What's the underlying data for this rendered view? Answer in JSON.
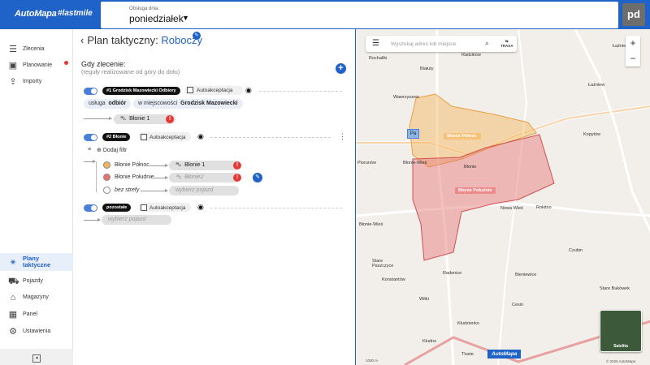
{
  "app": {
    "brand": "AutoMapa",
    "brand_tag": "#lastmile",
    "avatar": "pd"
  },
  "day": {
    "label": "Obsługa dnia:",
    "value": "poniedziałek"
  },
  "sidebar": {
    "items": [
      {
        "label": "Zlecenia",
        "icon": "list-icon"
      },
      {
        "label": "Planowanie",
        "icon": "calendar-icon"
      },
      {
        "label": "Importy",
        "icon": "import-icon"
      }
    ],
    "bottom_items": [
      {
        "label": "Plany taktyczne",
        "icon": "plan-icon"
      },
      {
        "label": "Pojazdy",
        "icon": "truck-icon"
      },
      {
        "label": "Magazyny",
        "icon": "warehouse-icon"
      },
      {
        "label": "Panel",
        "icon": "grid-icon"
      },
      {
        "label": "Ustawienia",
        "icon": "gear-icon"
      }
    ]
  },
  "plan": {
    "title": "Plan taktyczny:",
    "status": "Roboczy",
    "rule_title": "Gdy zlecenie:",
    "rule_sub": "(reguły realizowane od góry do dołu)",
    "rules": [
      {
        "name": "#1 Grodzisk Mazowiecki Odbiory",
        "auto_label": "Autoakceptacja",
        "conditions": [
          {
            "key": "usługa",
            "value": "odbiór"
          },
          {
            "key": "w miejscowości",
            "value": "Grodzisk Mazowiecki"
          }
        ],
        "vehicle": "Błonie 1"
      },
      {
        "name": "#2 Błonie",
        "auto_label": "Autoakceptacja",
        "add_filter": "Dodaj filtr",
        "zones": [
          {
            "label": "Błonie Północ",
            "vehicle": "Błonie 1",
            "color": "#f4b45a"
          },
          {
            "label": "Błonie Południe",
            "vehicle": "Błonie2",
            "color": "#e57373"
          },
          {
            "label": "bez strefy",
            "vehicle": "wybierz pojazd",
            "color": "#ffffff"
          }
        ]
      },
      {
        "name": "pozostałe",
        "auto_label": "Autoakceptacja",
        "vehicle": "wybierz pojazd"
      }
    ]
  },
  "map": {
    "search_placeholder": "Wyszukaj adres lub miejsce",
    "route_label": "TRASA",
    "zoom_in": "+",
    "zoom_out": "−",
    "satellite": "Satelita",
    "badge": "AutoMapa",
    "copyright": "© 2026 AutoMapa",
    "scale": "1000 m",
    "parking": "Pa",
    "zone_labels": [
      "Błonie Północ",
      "Błonie Południe"
    ],
    "places": [
      "Radzików",
      "Łaźniewek",
      "Rochaliki",
      "Białuty",
      "Łaźniew",
      "Wawrzyszew",
      "Kopytów",
      "Błonie-Wieś",
      "Błonie",
      "Piorunów",
      "Nowa Wieś",
      "Rokitno",
      "Stare Paszczyce",
      "Czubin",
      "Konstantów",
      "Radonice",
      "Bieniewice",
      "Witki",
      "Błonie-Wieś",
      "Cesin",
      "Kłudzienko",
      "Kłudno",
      "Stare Bukówek",
      "Tluste"
    ]
  },
  "colors": {
    "brand": "#1f63c9",
    "zone_north": "#f4b45a",
    "zone_south": "#e57373",
    "error": "#e53935"
  }
}
